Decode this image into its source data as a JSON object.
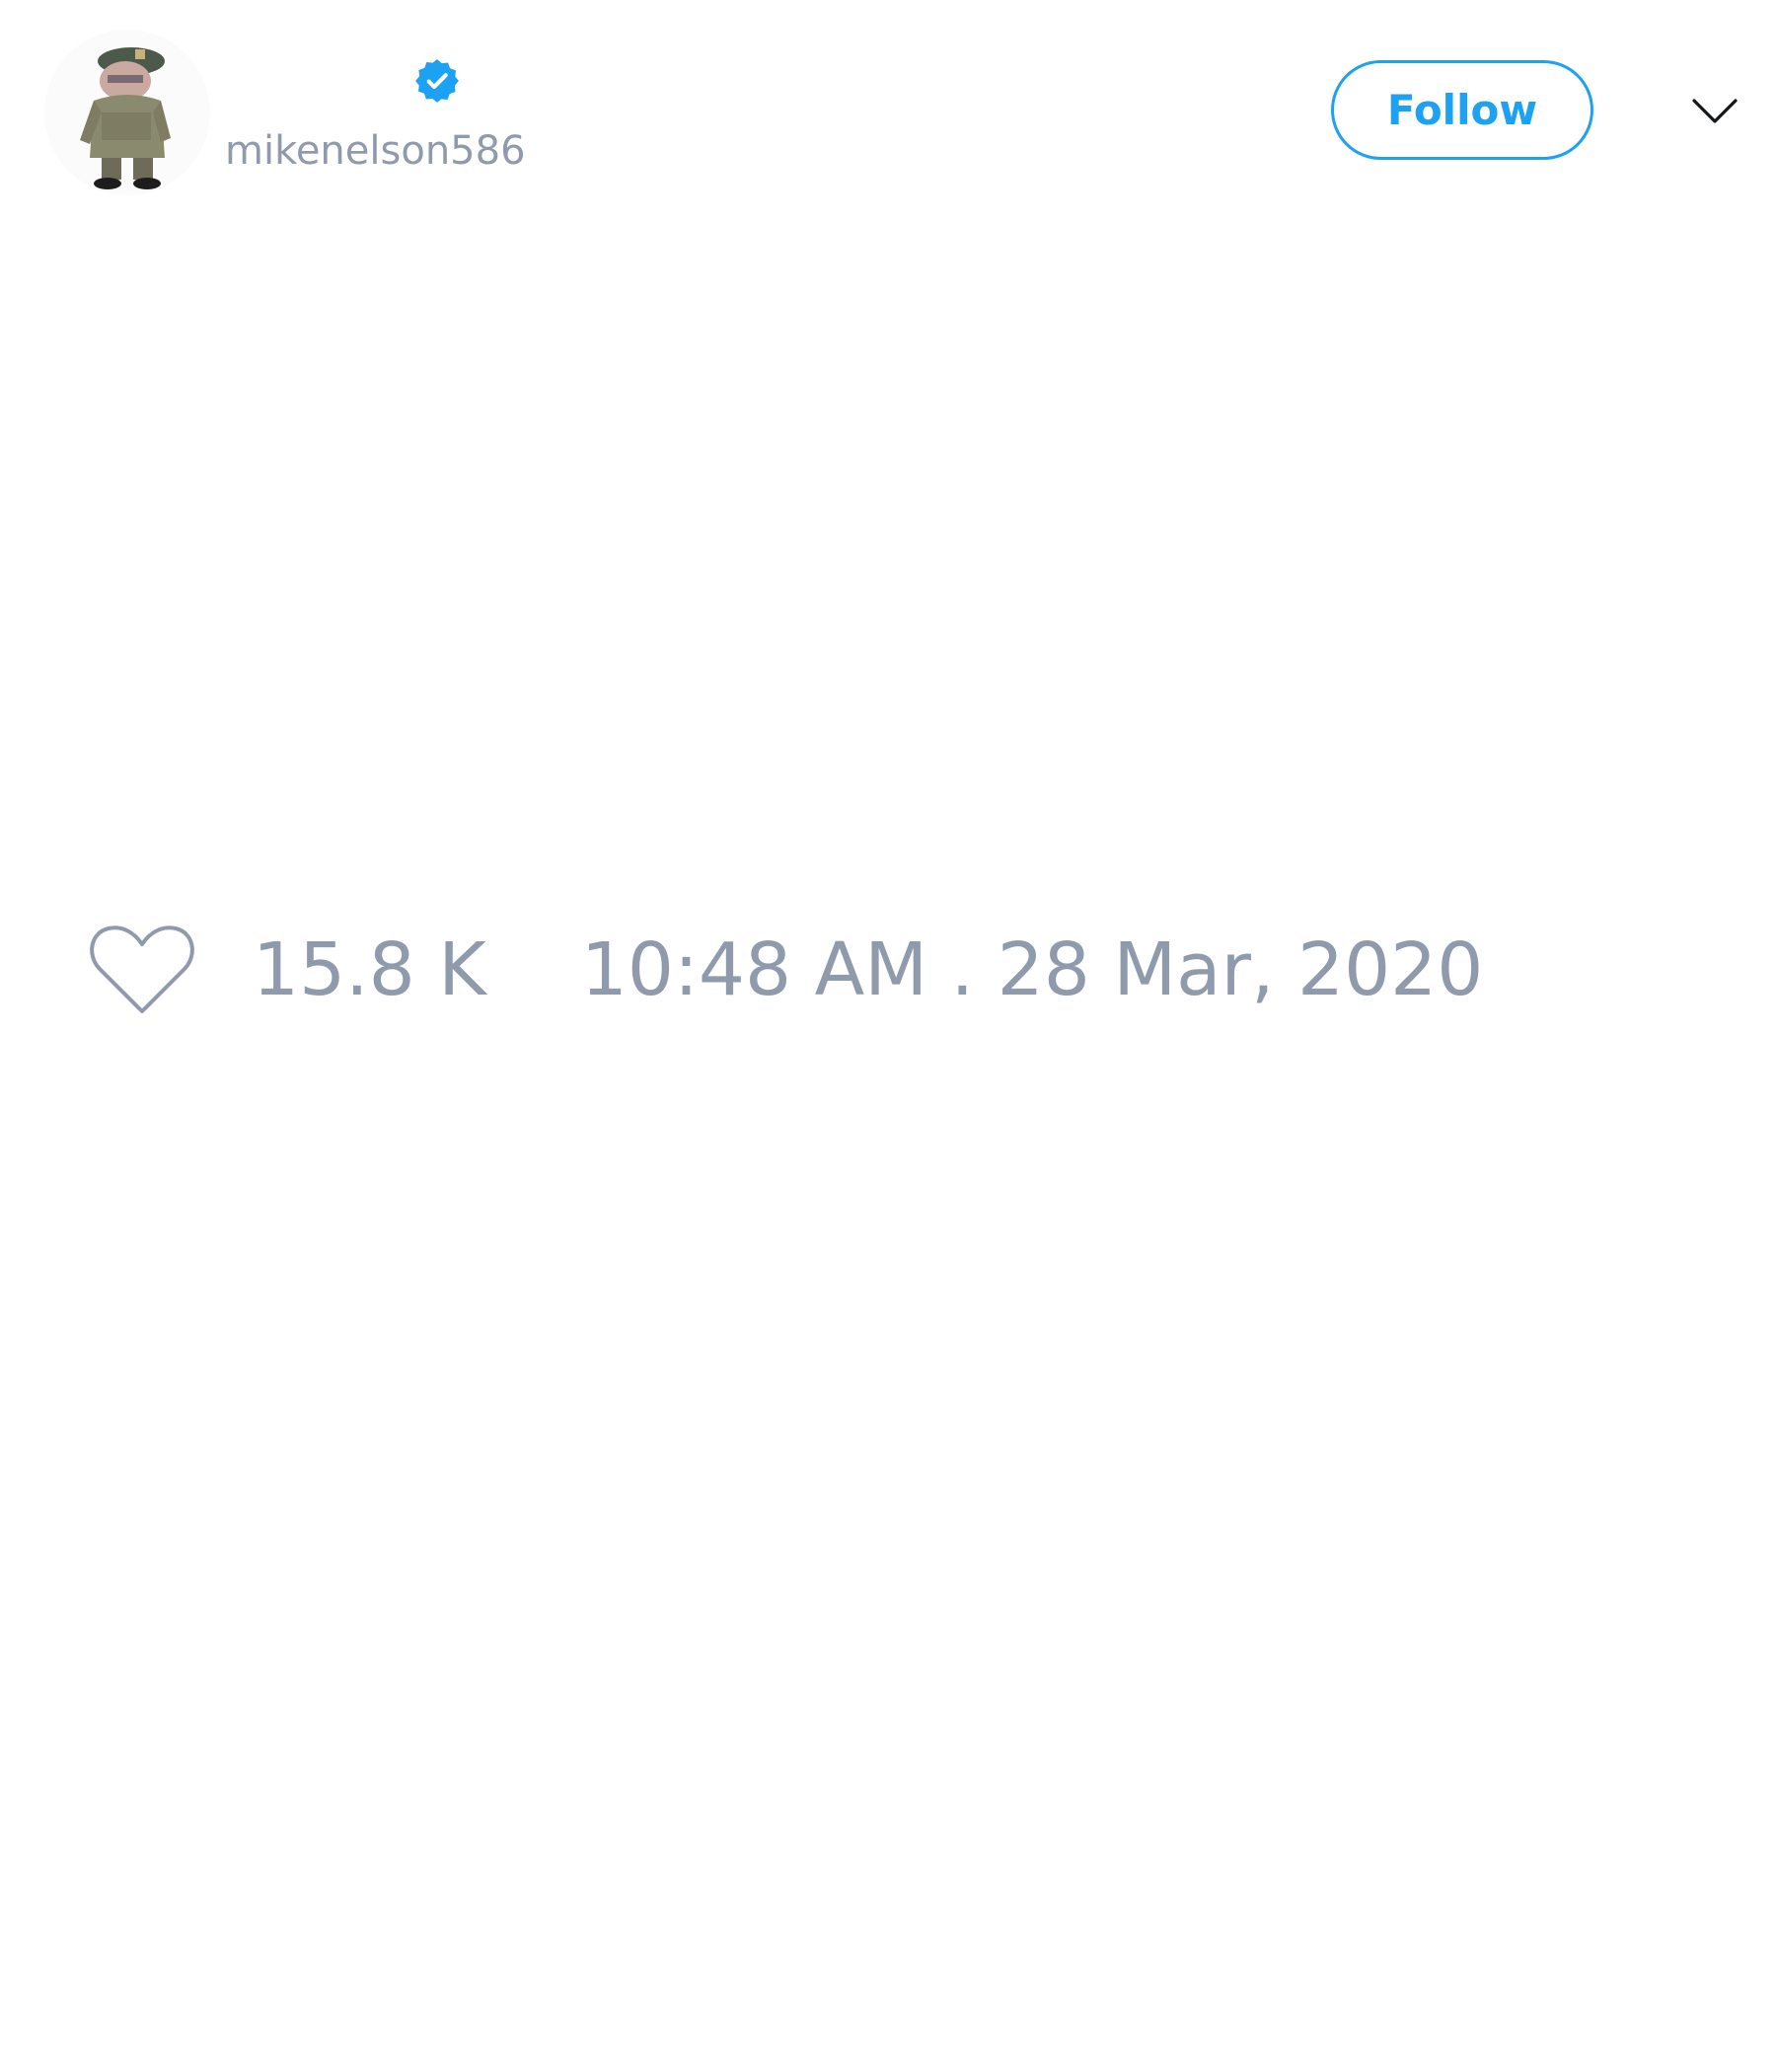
{
  "colors": {
    "accent": "#1da1f2",
    "muted_text": "#8f9bad"
  },
  "user": {
    "avatar_icon": "soldier-avatar",
    "display_name": "",
    "verified_icon": "verified-badge-icon",
    "handle": "mikenelson586"
  },
  "actions": {
    "follow_label": "Follow",
    "menu_icon": "chevron-down-icon"
  },
  "tweet": {
    "text": "",
    "like_icon": "heart-outline-icon",
    "like_count": "15.8 K",
    "timestamp": "10:48 AM . 28 Mar, 2020"
  }
}
